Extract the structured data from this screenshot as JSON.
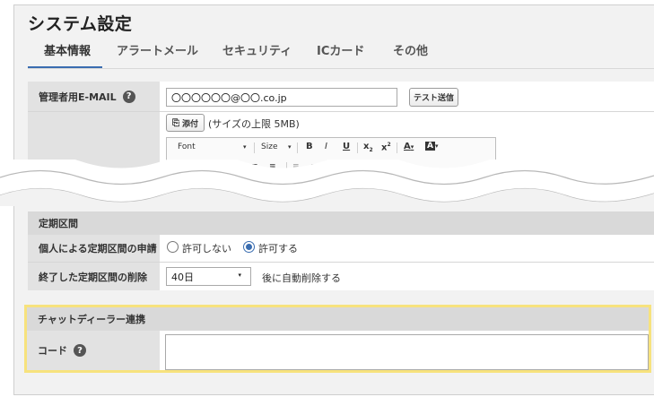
{
  "page": {
    "title": "システム設定"
  },
  "tabs": [
    {
      "label": "基本情報",
      "active": true
    },
    {
      "label": "アラートメール",
      "active": false
    },
    {
      "label": "セキュリティ",
      "active": false
    },
    {
      "label": "ICカード",
      "active": false
    },
    {
      "label": "その他",
      "active": false
    }
  ],
  "email_row": {
    "label": "管理者用E-MAIL",
    "value": "〇〇〇〇〇〇@〇〇.co.jp",
    "test_button": "テスト送信"
  },
  "attach_row": {
    "attach_button": "添付",
    "size_note": "(サイズの上限 5MB)"
  },
  "editor_toolbar": {
    "font_select": "Font",
    "size_select": "Size",
    "bold": "B",
    "italic": "I",
    "underline": "U",
    "subscript": "x",
    "superscript": "x",
    "text_color": "A",
    "bg_color": "A"
  },
  "period_section": {
    "header": "定期区間",
    "apply_label": "個人による定期区間の申請",
    "option_deny": "許可しない",
    "option_allow": "許可する",
    "selected": "許可する",
    "delete_label": "終了した定期区間の削除",
    "delete_select": "40日",
    "delete_suffix": "後に自動削除する"
  },
  "chat_section": {
    "header": "チャットディーラー連携",
    "code_label": "コード",
    "code_value": ""
  },
  "colors": {
    "accent": "#3a6db0",
    "highlight": "#f7e27d",
    "label_bg": "#e2e2e2",
    "panel_bg": "#f2f2f2"
  }
}
